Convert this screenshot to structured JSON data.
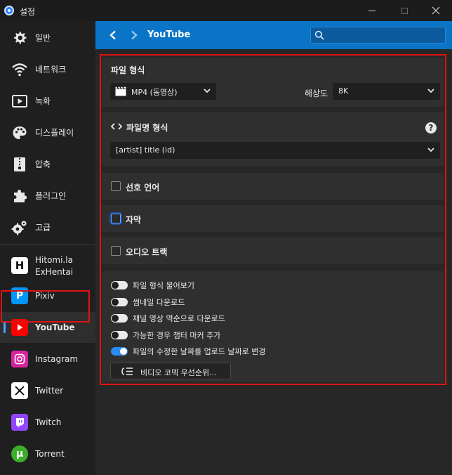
{
  "window": {
    "title": "설정"
  },
  "sidebar": {
    "items": [
      {
        "label": "일반",
        "icon": "gear-icon"
      },
      {
        "label": "네트워크",
        "icon": "wifi-icon"
      },
      {
        "label": "녹화",
        "icon": "play-icon"
      },
      {
        "label": "디스플레이",
        "icon": "palette-icon"
      },
      {
        "label": "압축",
        "icon": "zip-icon"
      },
      {
        "label": "플러그인",
        "icon": "puzzle-icon"
      },
      {
        "label": "고급",
        "icon": "gears-icon"
      }
    ],
    "sites": [
      {
        "label": "Hitomi.la\nExHentai",
        "line1": "Hitomi.la",
        "line2": "ExHentai",
        "icon": "hitomi-logo-icon"
      },
      {
        "label": "Pixiv",
        "icon": "pixiv-logo-icon"
      },
      {
        "label": "YouTube",
        "icon": "youtube-logo-icon",
        "active": true
      },
      {
        "label": "Instagram",
        "icon": "instagram-logo-icon"
      },
      {
        "label": "Twitter",
        "icon": "x-logo-icon"
      },
      {
        "label": "Twitch",
        "icon": "twitch-logo-icon"
      },
      {
        "label": "Torrent",
        "icon": "utorrent-logo-icon"
      }
    ]
  },
  "header": {
    "title": "YouTube",
    "search_placeholder": ""
  },
  "file_format": {
    "title": "파일 형식",
    "format_value": "MP4 (동영상)",
    "resolution_label": "해상도",
    "resolution_value": "8K"
  },
  "filename_format": {
    "title": "파일명 형식",
    "value": "[artist] title (id)"
  },
  "checkboxes": {
    "preferred_language": "선호 언어",
    "subtitles": "자막",
    "audio_track": "오디오 트랙"
  },
  "toggles": [
    {
      "label": "파일 형식 물어보기",
      "on": false
    },
    {
      "label": "썸네일 다운로드",
      "on": false
    },
    {
      "label": "채널 영상 역순으로 다운로드",
      "on": false
    },
    {
      "label": "가능한 경우 챕터 마커 추가",
      "on": false
    },
    {
      "label": "파일의 수정한 날짜를 업로드 날짜로 변경",
      "on": true
    }
  ],
  "codec_button": {
    "label": "비디오 코덱 우선순위..."
  },
  "colors": {
    "accent": "#0a74c7",
    "highlight": "#e01313",
    "toggle_on": "#2a8cf0"
  }
}
